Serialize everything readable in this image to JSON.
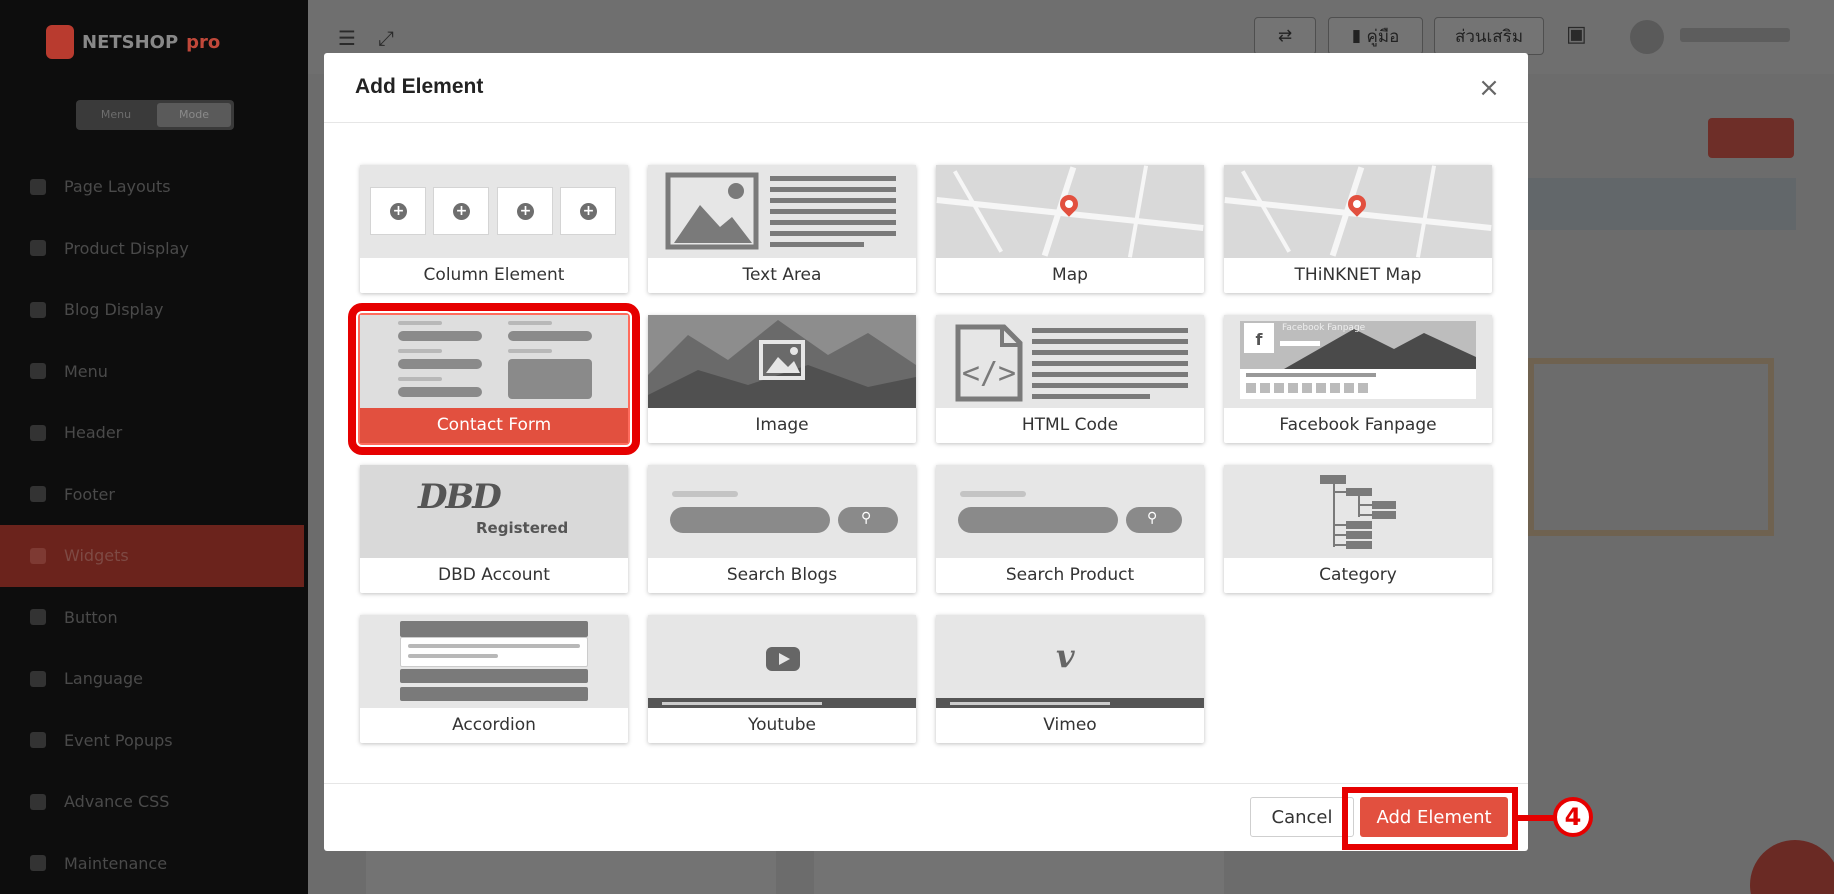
{
  "sidebar": {
    "logo_text_1": "NETSHOP",
    "logo_text_2": "pro",
    "toggle": [
      "Menu",
      "Mode"
    ],
    "items": [
      {
        "label": "Page Layouts"
      },
      {
        "label": "Product Display"
      },
      {
        "label": "Blog Display"
      },
      {
        "label": "Menu"
      },
      {
        "label": "Header"
      },
      {
        "label": "Footer"
      },
      {
        "label": "Widgets"
      },
      {
        "label": "Button"
      },
      {
        "label": "Language"
      },
      {
        "label": "Event Popups"
      },
      {
        "label": "Advance CSS"
      },
      {
        "label": "Maintenance"
      }
    ]
  },
  "topbar": {
    "manual_label": "คู่มือ",
    "addons_label": "ส่วนเสริม"
  },
  "modal": {
    "title": "Add Element",
    "tiles": [
      {
        "label": "Column Element"
      },
      {
        "label": "Text Area"
      },
      {
        "label": "Map"
      },
      {
        "label": "THiNKNET Map"
      },
      {
        "label": "Contact Form",
        "selected": true
      },
      {
        "label": "Image"
      },
      {
        "label": "HTML Code"
      },
      {
        "label": "Facebook Fanpage"
      },
      {
        "label": "DBD Account"
      },
      {
        "label": "Search Blogs"
      },
      {
        "label": "Search Product"
      },
      {
        "label": "Category"
      },
      {
        "label": "Accordion"
      },
      {
        "label": "Youtube"
      },
      {
        "label": "Vimeo"
      }
    ],
    "dbd_text": "DBD",
    "dbd_sub": "Registered",
    "fb_page_text": "Facebook Fanpage",
    "cancel_label": "Cancel",
    "add_label": "Add Element"
  },
  "annotation": {
    "step_number": "4"
  },
  "colors": {
    "accent": "#e2503f",
    "highlight": "#e60000"
  }
}
